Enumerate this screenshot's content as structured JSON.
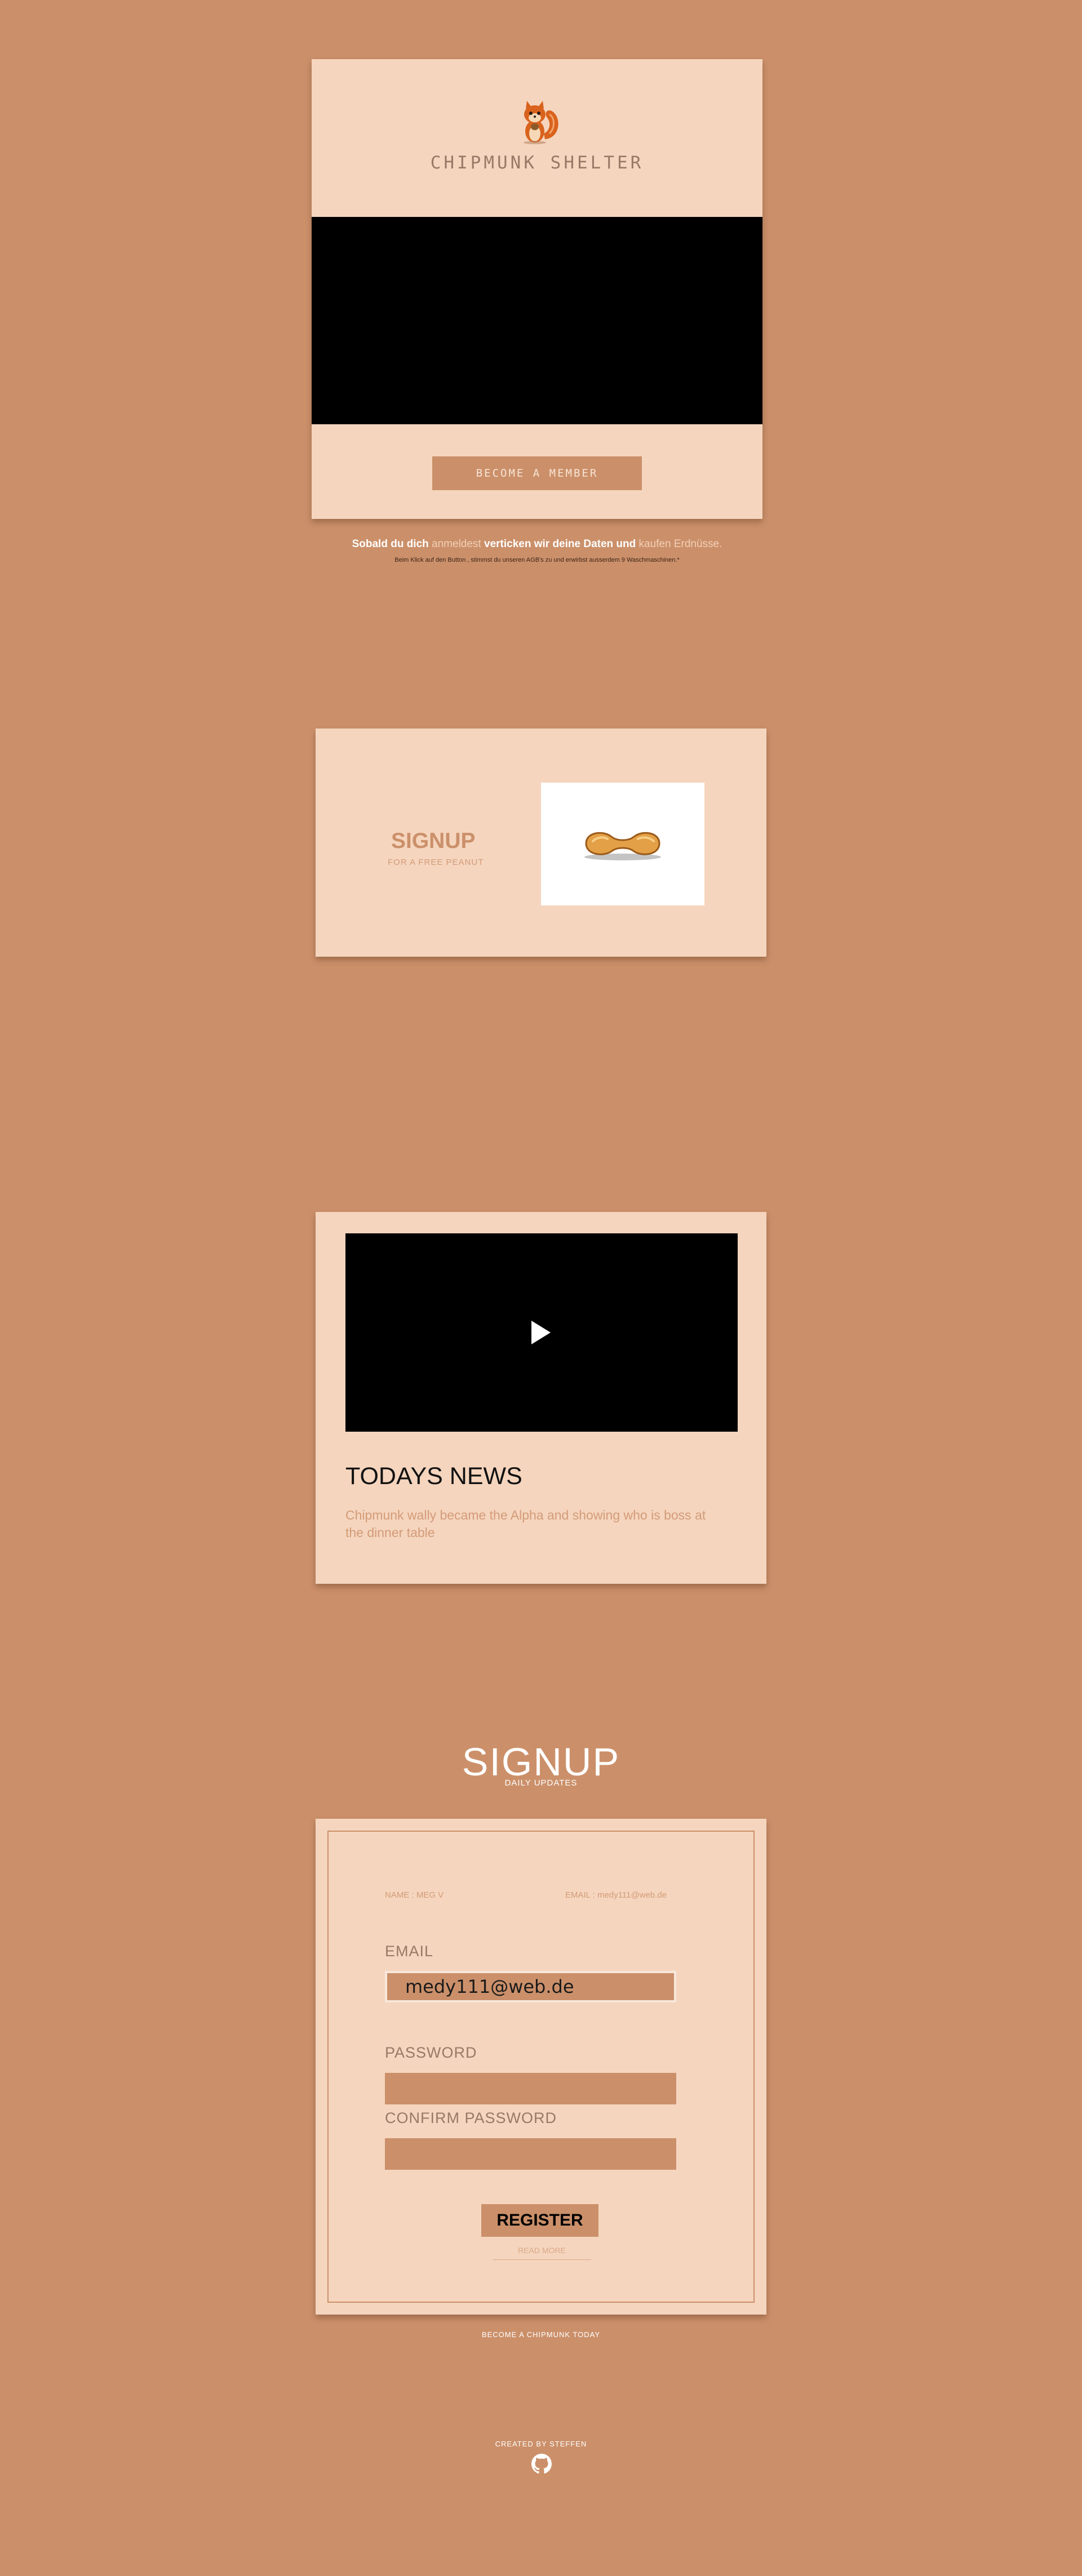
{
  "card1": {
    "brand": "CHIPMUNK SHELTER",
    "member_button": "BECOME A MEMBER",
    "logo_icon": "chipmunk-logo"
  },
  "notice": {
    "part1": "Sobald du dich ",
    "link1": "anmeldest",
    "part2": "  verticken wir deine Daten und ",
    "link2": "kaufen Erdnüsse.",
    "small": "Beim Klick auf den Button , stimmst du unseren AGB's zu und erwirbst ausserdem 9 Waschmaschinen.*"
  },
  "card2": {
    "title": "SIGNUP",
    "subtitle": "FOR A FREE  PEANUT",
    "image_icon": "peanut-icon"
  },
  "card3": {
    "news_title": "TODAYS NEWS",
    "news_text": "Chipmunk wally became the Alpha and showing who is boss at the dinner table"
  },
  "signup": {
    "title": "SIGNUP",
    "subtitle": "DAILY UPDATES",
    "name_meta": "NAME : MEG V",
    "email_meta": "EMAIL : medy111@web.de",
    "email_label": "EMAIL",
    "email_value": "medy111@web.de",
    "password_label": "PASSWORD",
    "confirm_label": "CONFIRM PASSWORD",
    "register_button": "REGISTER",
    "read_more": "READ MORE",
    "become_today": "BECOME A CHIPMUNK TODAY"
  },
  "footer": {
    "created_by": "CREATED BY STEFFEN",
    "github_icon": "github-icon"
  },
  "colors": {
    "background": "#cb906a",
    "card": "#f5d5be",
    "accent": "#cb906a"
  }
}
